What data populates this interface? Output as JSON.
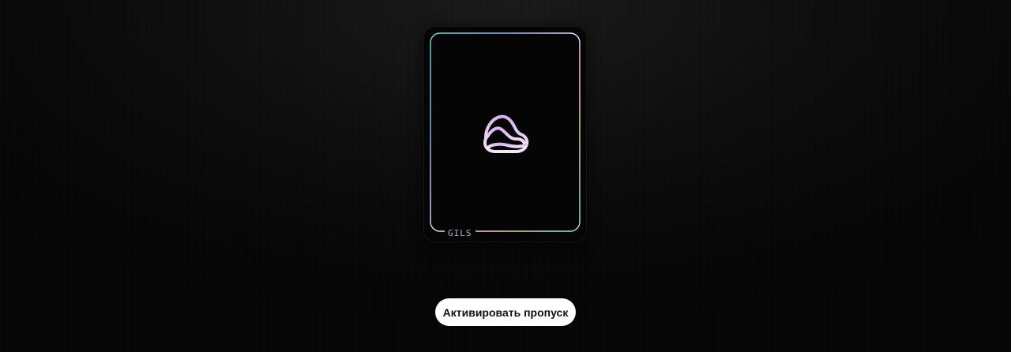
{
  "card": {
    "label": "GILS",
    "logo_icon": "mountain-cloud-logo-icon",
    "frame_gradient": [
      "#5fe0c9",
      "#8fb3ff",
      "#f0d7ff",
      "#e8d9a8",
      "#9be7d9"
    ],
    "logo_gradient": [
      "#d6b4ee",
      "#f1e7f8"
    ]
  },
  "actions": {
    "activate_label": "Активировать пропуск"
  },
  "colors": {
    "background": "#0a0a0a",
    "button_background": "#ffffff",
    "button_text": "#111111"
  }
}
